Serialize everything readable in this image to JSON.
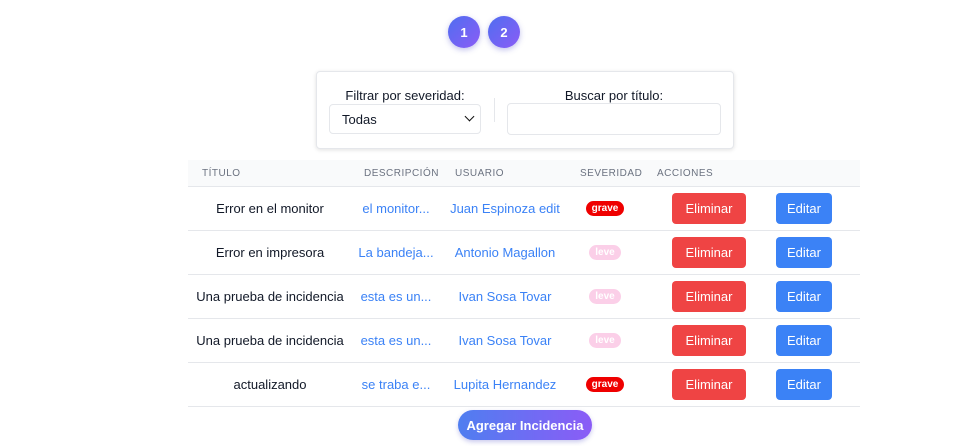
{
  "pagination": {
    "pages": [
      "1",
      "2"
    ]
  },
  "filters": {
    "severity_label": "Filtrar por severidad:",
    "severity_value": "Todas",
    "search_label": "Buscar por título:",
    "search_value": ""
  },
  "table": {
    "headers": [
      "TÍTULO",
      "DESCRIPCIÓN",
      "USUARIO",
      "SEVERIDAD",
      "ACCIONES"
    ],
    "rows": [
      {
        "title": "Error en el monitor",
        "description": "el monitor...",
        "user": "Juan Espinoza edit",
        "severity": "grave",
        "delete_label": "Eliminar",
        "edit_label": "Editar"
      },
      {
        "title": "Error en impresora",
        "description": "La bandeja...",
        "user": "Antonio Magallon",
        "severity": "leve",
        "delete_label": "Eliminar",
        "edit_label": "Editar"
      },
      {
        "title": "Una prueba de incidencia",
        "description": "esta es un...",
        "user": "Ivan Sosa Tovar",
        "severity": "leve",
        "delete_label": "Eliminar",
        "edit_label": "Editar"
      },
      {
        "title": "Una prueba de incidencia",
        "description": "esta es un...",
        "user": "Ivan Sosa Tovar",
        "severity": "leve",
        "delete_label": "Eliminar",
        "edit_label": "Editar"
      },
      {
        "title": "actualizando",
        "description": "se traba e...",
        "user": "Lupita Hernandez",
        "severity": "grave",
        "delete_label": "Eliminar",
        "edit_label": "Editar"
      }
    ]
  },
  "add_button_label": "Agregar Incidencia",
  "colors": {
    "grave": "#ef0000",
    "leve": "#fbcfe8",
    "delete": "#ef4444",
    "edit": "#3b82f6",
    "link": "#3b82f6"
  }
}
